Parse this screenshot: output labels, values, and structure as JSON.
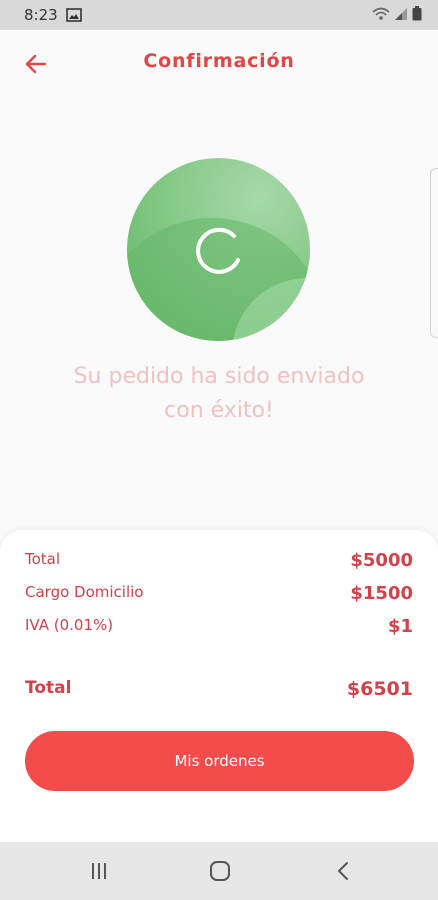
{
  "status_bar": {
    "time": "8:23",
    "icons": [
      "image-icon",
      "wifi-icon",
      "signal-icon",
      "battery-icon"
    ]
  },
  "header": {
    "title": "Confirmación",
    "back_icon": "arrow-left-icon"
  },
  "status_graphic": {
    "icon": "loading-spinner-icon",
    "color": "#7cc47f"
  },
  "message": {
    "line1": "Su pedido ha sido enviado",
    "line2": "con éxito!"
  },
  "summary": {
    "rows": [
      {
        "label": "Total",
        "value": "$5000"
      },
      {
        "label": "Cargo Domicilio",
        "value": "$1500"
      },
      {
        "label": "IVA (0.01%)",
        "value": "$1"
      }
    ],
    "total": {
      "label": "Total",
      "value": "$6501"
    }
  },
  "primary_button": {
    "label": "Mis ordenes"
  },
  "nav_bar": {
    "icons": [
      "recents-icon",
      "home-icon",
      "back-icon"
    ]
  },
  "colors": {
    "accent": "#e04848",
    "button": "#f44b4b",
    "success": "#7cc47f",
    "message": "#efc2c2"
  }
}
